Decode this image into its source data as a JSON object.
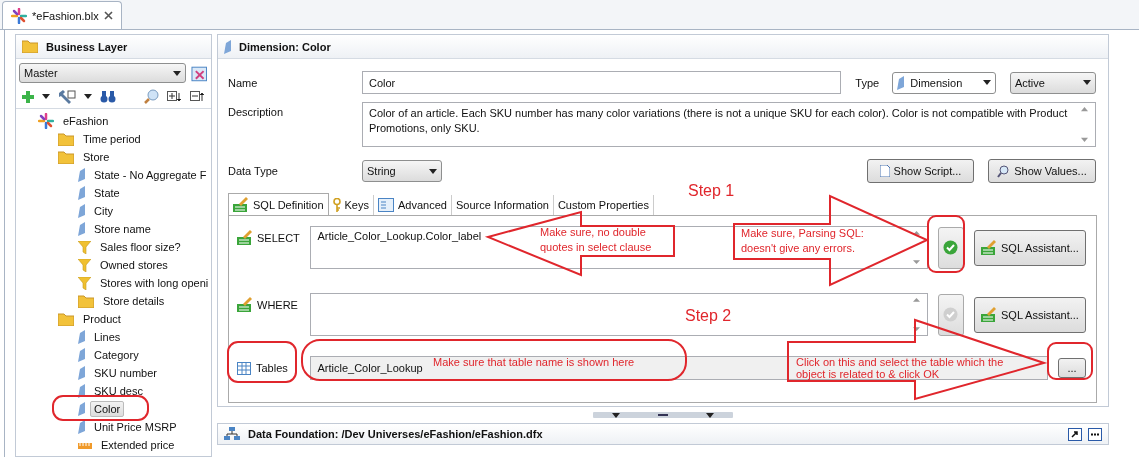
{
  "editor_tab": {
    "title": "*eFashion.blx"
  },
  "business_layer": {
    "title": "Business Layer",
    "view": "Master",
    "tree": [
      {
        "label": "eFashion",
        "kind": "universe",
        "selected": false,
        "children": [
          {
            "label": "Time period",
            "kind": "folder",
            "selected": false
          },
          {
            "label": "Store",
            "kind": "folder",
            "selected": false,
            "children": [
              {
                "label": "State - No Aggregate F",
                "kind": "dimension",
                "selected": false
              },
              {
                "label": "State",
                "kind": "dimension",
                "selected": false
              },
              {
                "label": "City",
                "kind": "dimension",
                "selected": false
              },
              {
                "label": "Store name",
                "kind": "dimension",
                "selected": false
              },
              {
                "label": "Sales floor size?",
                "kind": "filter",
                "selected": false
              },
              {
                "label": "Owned stores",
                "kind": "filter",
                "selected": false
              },
              {
                "label": "Stores with long openi",
                "kind": "filter",
                "selected": false
              },
              {
                "label": "Store details",
                "kind": "folder",
                "selected": false
              }
            ]
          },
          {
            "label": "Product",
            "kind": "folder",
            "selected": false,
            "children": [
              {
                "label": "Lines",
                "kind": "dimension",
                "selected": false
              },
              {
                "label": "Category",
                "kind": "dimension",
                "selected": false
              },
              {
                "label": "SKU number",
                "kind": "dimension",
                "selected": false
              },
              {
                "label": "SKU desc",
                "kind": "dimension",
                "selected": false
              },
              {
                "label": "Color",
                "kind": "dimension",
                "selected": true
              },
              {
                "label": "Unit Price MSRP",
                "kind": "dimension",
                "selected": false
              },
              {
                "label": "Extended price",
                "kind": "measure",
                "selected": false
              }
            ]
          }
        ]
      }
    ]
  },
  "dimension_panel": {
    "title": "Dimension: Color",
    "name_label": "Name",
    "name": "Color",
    "type_label": "Type",
    "type": "Dimension",
    "status": "Active",
    "description_label": "Description",
    "description": "Color of an article. Each SKU number has many color variations (there is not a unique SKU for each color). Color is not compatible with Product Promotions, only SKU.",
    "data_type_label": "Data Type",
    "data_type": "String",
    "buttons": [
      "Show Script...",
      "Show Values..."
    ],
    "tabs": [
      {
        "label": "SQL Definition",
        "kind": "sql",
        "selected": true
      },
      {
        "label": "Keys",
        "kind": "key",
        "selected": false
      },
      {
        "label": "Advanced",
        "kind": "advanced",
        "selected": false
      },
      {
        "label": "Source Information",
        "kind": "plain",
        "selected": false
      },
      {
        "label": "Custom Properties",
        "kind": "plain",
        "selected": false
      }
    ],
    "clauses": [
      {
        "label": "SELECT",
        "value": "Article_Color_Lookup.Color_label",
        "parse_enabled": true,
        "assistant": "SQL Assistant..."
      },
      {
        "label": "WHERE",
        "parse_enabled": false,
        "assistant": "SQL Assistant..."
      }
    ],
    "tables": {
      "label": "Tables",
      "value": "Article_Color_Lookup",
      "browse": "..."
    }
  },
  "bottom_panel": {
    "title": "Data Foundation: /Dev Universes/eFashion/eFashion.dfx"
  },
  "annotations": {
    "steps": [
      "Step 1",
      "Step 2"
    ],
    "notes": [
      "Make sure, no double quotes in select clause",
      "Make sure, Parsing SQL: doesn't give any errors.",
      "Make sure that table name is shown here",
      "Click on this and select the table which the object is related to & click OK"
    ]
  }
}
